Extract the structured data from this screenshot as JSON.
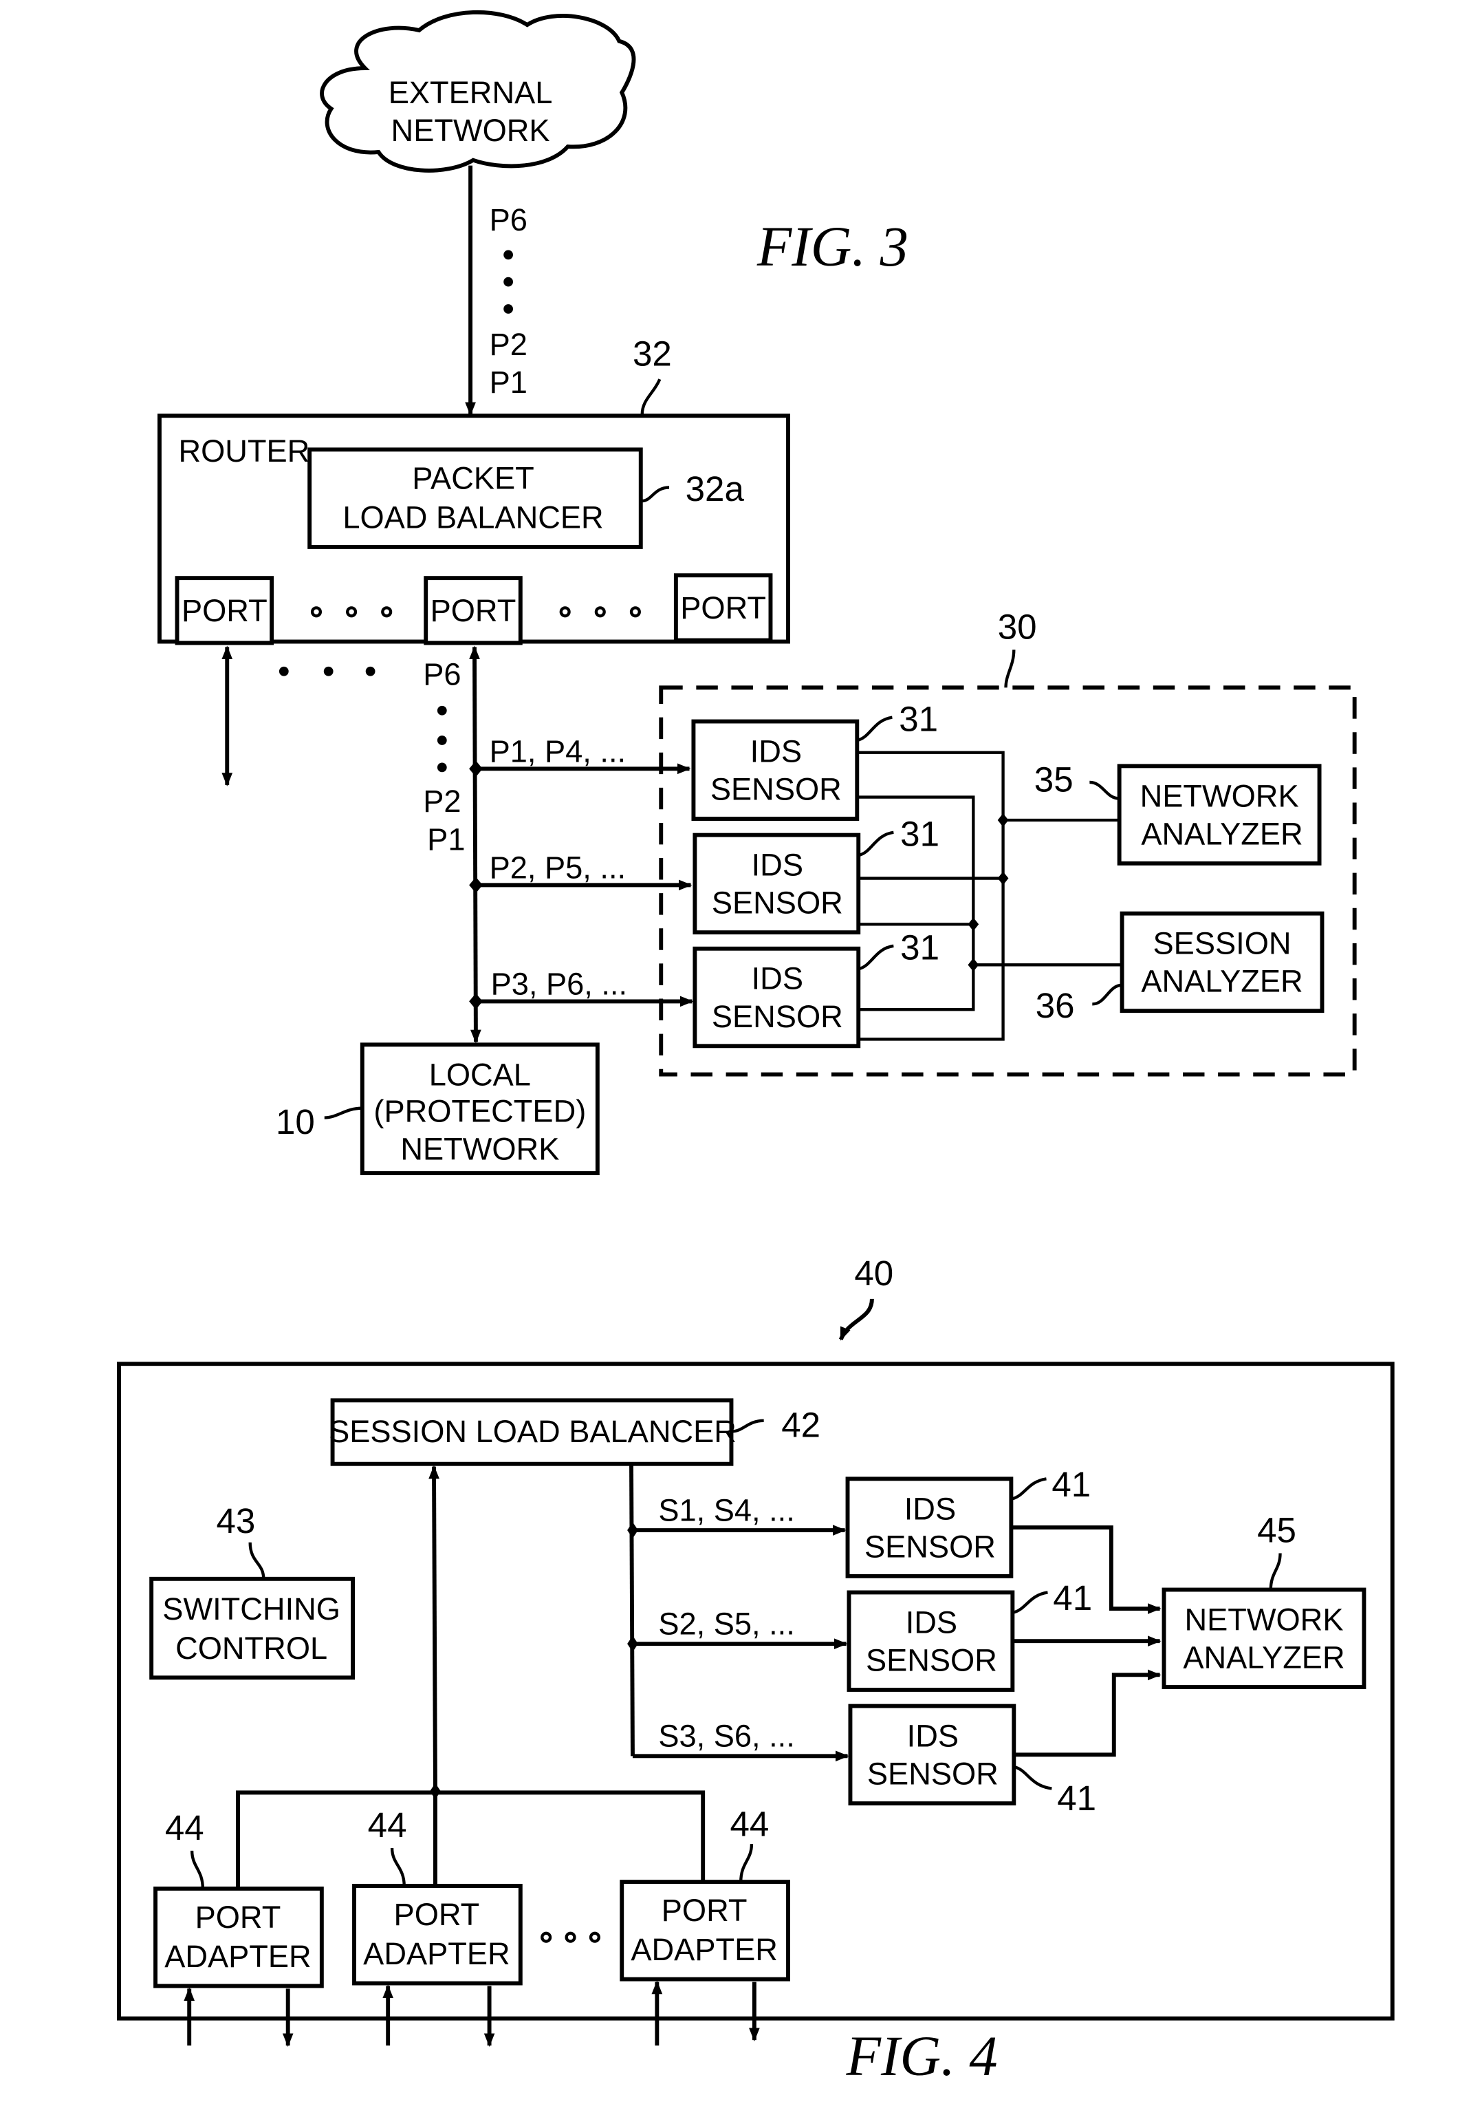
{
  "fig3": {
    "caption": "FIG.  3",
    "external_network": {
      "line1": "EXTERNAL",
      "line2": "NETWORK"
    },
    "incoming_packets": {
      "top": "P6",
      "p2": "P2",
      "p1": "P1"
    },
    "router": {
      "ref": "32",
      "label": "ROUTER",
      "load_balancer": {
        "line1": "PACKET",
        "line2": "LOAD BALANCER",
        "ref": "32a"
      },
      "ports": [
        "PORT",
        "PORT",
        "PORT"
      ]
    },
    "port_stream": {
      "top": "P6",
      "p2": "P2",
      "p1": "P1"
    },
    "ids_group_ref": "30",
    "flows": [
      "P1,  P4,  ...",
      "P2,  P5,  ...",
      "P3,  P6,  ..."
    ],
    "sensors": [
      {
        "line1": "IDS",
        "line2": "SENSOR",
        "ref": "31"
      },
      {
        "line1": "IDS",
        "line2": "SENSOR",
        "ref": "31"
      },
      {
        "line1": "IDS",
        "line2": "SENSOR",
        "ref": "31"
      }
    ],
    "network_analyzer": {
      "line1": "NETWORK",
      "line2": "ANALYZER",
      "ref": "35"
    },
    "session_analyzer": {
      "line1": "SESSION",
      "line2": "ANALYZER",
      "ref": "36"
    },
    "local_network": {
      "line1": "LOCAL",
      "line2": "(PROTECTED)",
      "line3": "NETWORK",
      "ref": "10"
    }
  },
  "fig4": {
    "caption": "FIG.  4",
    "system_ref": "40",
    "session_load_balancer": {
      "label": "SESSION  LOAD  BALANCER",
      "ref": "42"
    },
    "switching_control": {
      "line1": "SWITCHING",
      "line2": "CONTROL",
      "ref": "43"
    },
    "flows": [
      "S1,  S4,  ...",
      "S2,  S5,  ...",
      "S3,  S6,  ..."
    ],
    "sensors": [
      {
        "line1": "IDS",
        "line2": "SENSOR",
        "ref": "41"
      },
      {
        "line1": "IDS",
        "line2": "SENSOR",
        "ref": "41"
      },
      {
        "line1": "IDS",
        "line2": "SENSOR",
        "ref": "41"
      }
    ],
    "network_analyzer": {
      "line1": "NETWORK",
      "line2": "ANALYZER",
      "ref": "45"
    },
    "port_adapters": [
      {
        "line1": "PORT",
        "line2": "ADAPTER",
        "ref": "44"
      },
      {
        "line1": "PORT",
        "line2": "ADAPTER",
        "ref": "44"
      },
      {
        "line1": "PORT",
        "line2": "ADAPTER",
        "ref": "44"
      }
    ]
  }
}
